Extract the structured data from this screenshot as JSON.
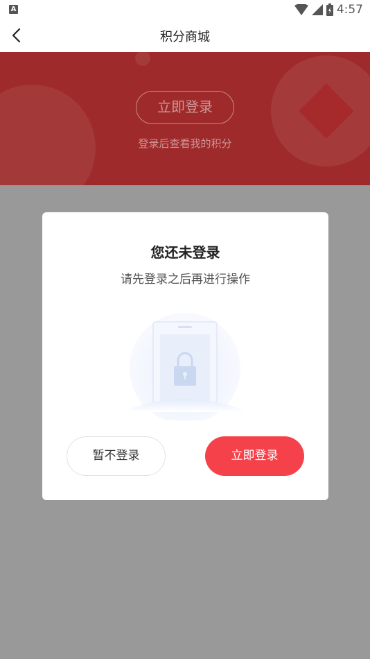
{
  "status_bar": {
    "notification_badge": "A",
    "time": "4:57",
    "icons": [
      "wifi-icon",
      "signal-icon",
      "battery-icon"
    ]
  },
  "navbar": {
    "title": "积分商城",
    "back_icon": "chevron-left-icon"
  },
  "banner": {
    "login_button_label": "立即登录",
    "subtitle": "登录后查看我的积分"
  },
  "modal": {
    "title": "您还未登录",
    "subtitle": "请先登录之后再进行操作",
    "illustration": "lock-phone-icon",
    "later_button_label": "暂不登录",
    "login_button_label": "立即登录"
  },
  "colors": {
    "banner_red": "#9e2a2b",
    "accent_red": "#f5414a",
    "overlay_gray": "#999999"
  }
}
